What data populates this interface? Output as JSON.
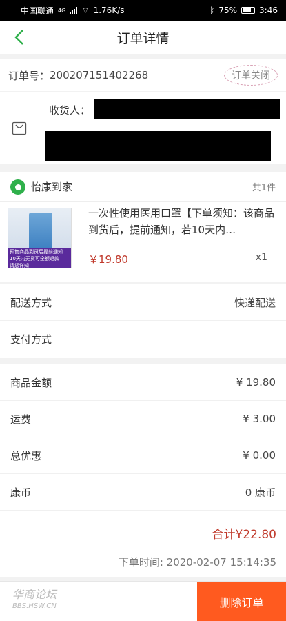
{
  "statusbar": {
    "carrier": "中国联通",
    "network": "4G",
    "speed": "1.76K/s",
    "battery": "75%",
    "time": "3:46"
  },
  "nav": {
    "title": "订单详情"
  },
  "order": {
    "label": "订单号：",
    "number": "200207151402268",
    "status": "订单关闭"
  },
  "address": {
    "receiver_label": "收货人："
  },
  "shop": {
    "name": "怡康到家",
    "count": "共1件",
    "logo_color": "#2fb04b"
  },
  "product": {
    "name": "一次性使用医用口罩【下单须知：该商品到货后，提前通知，若10天内…",
    "price": "￥19.80",
    "qty": "x1",
    "thumb_lines": [
      "预售商品到货后提前通知",
      "10天内无货可全额退款",
      "请您详知"
    ]
  },
  "delivery": [
    {
      "label": "配送方式",
      "value": "快递配送"
    },
    {
      "label": "支付方式",
      "value": ""
    }
  ],
  "amounts": [
    {
      "label": "商品金额",
      "value": "¥ 19.80"
    },
    {
      "label": "运费",
      "value": "¥ 3.00"
    },
    {
      "label": "总优惠",
      "value": "¥ 0.00"
    },
    {
      "label": "康币",
      "value": "0 康币"
    }
  ],
  "summary": {
    "total": "合计¥22.80",
    "time": "下单时间: 2020-02-07 15:14:35"
  },
  "bottom": {
    "watermark": "华商论坛",
    "watermark_sub": "BBS.HSW.CN",
    "delete_label": "删除订单",
    "accent": "#ff5a1f"
  }
}
